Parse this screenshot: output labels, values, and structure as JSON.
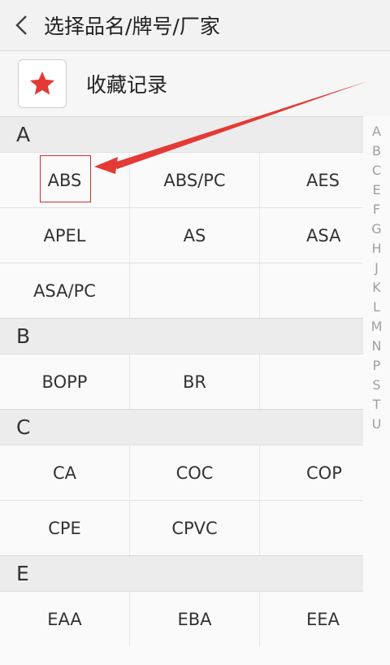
{
  "header": {
    "title": "选择品名/牌号/厂家"
  },
  "favorites": {
    "label": "收藏记录"
  },
  "sections": [
    {
      "letter": "A",
      "rows": [
        [
          "ABS",
          "ABS/PC",
          "AES"
        ],
        [
          "APEL",
          "AS",
          "ASA"
        ],
        [
          "ASA/PC",
          "",
          ""
        ]
      ]
    },
    {
      "letter": "B",
      "rows": [
        [
          "BOPP",
          "BR",
          ""
        ]
      ]
    },
    {
      "letter": "C",
      "rows": [
        [
          "CA",
          "COC",
          "COP"
        ],
        [
          "CPE",
          "CPVC",
          ""
        ]
      ]
    },
    {
      "letter": "E",
      "rows": [
        [
          "EAA",
          "EBA",
          "EEA"
        ]
      ]
    }
  ],
  "index_letters": [
    "A",
    "B",
    "C",
    "E",
    "F",
    "G",
    "H",
    "J",
    "K",
    "L",
    "M",
    "N",
    "P",
    "S",
    "T",
    "U"
  ],
  "colors": {
    "accent_red": "#e53935"
  }
}
